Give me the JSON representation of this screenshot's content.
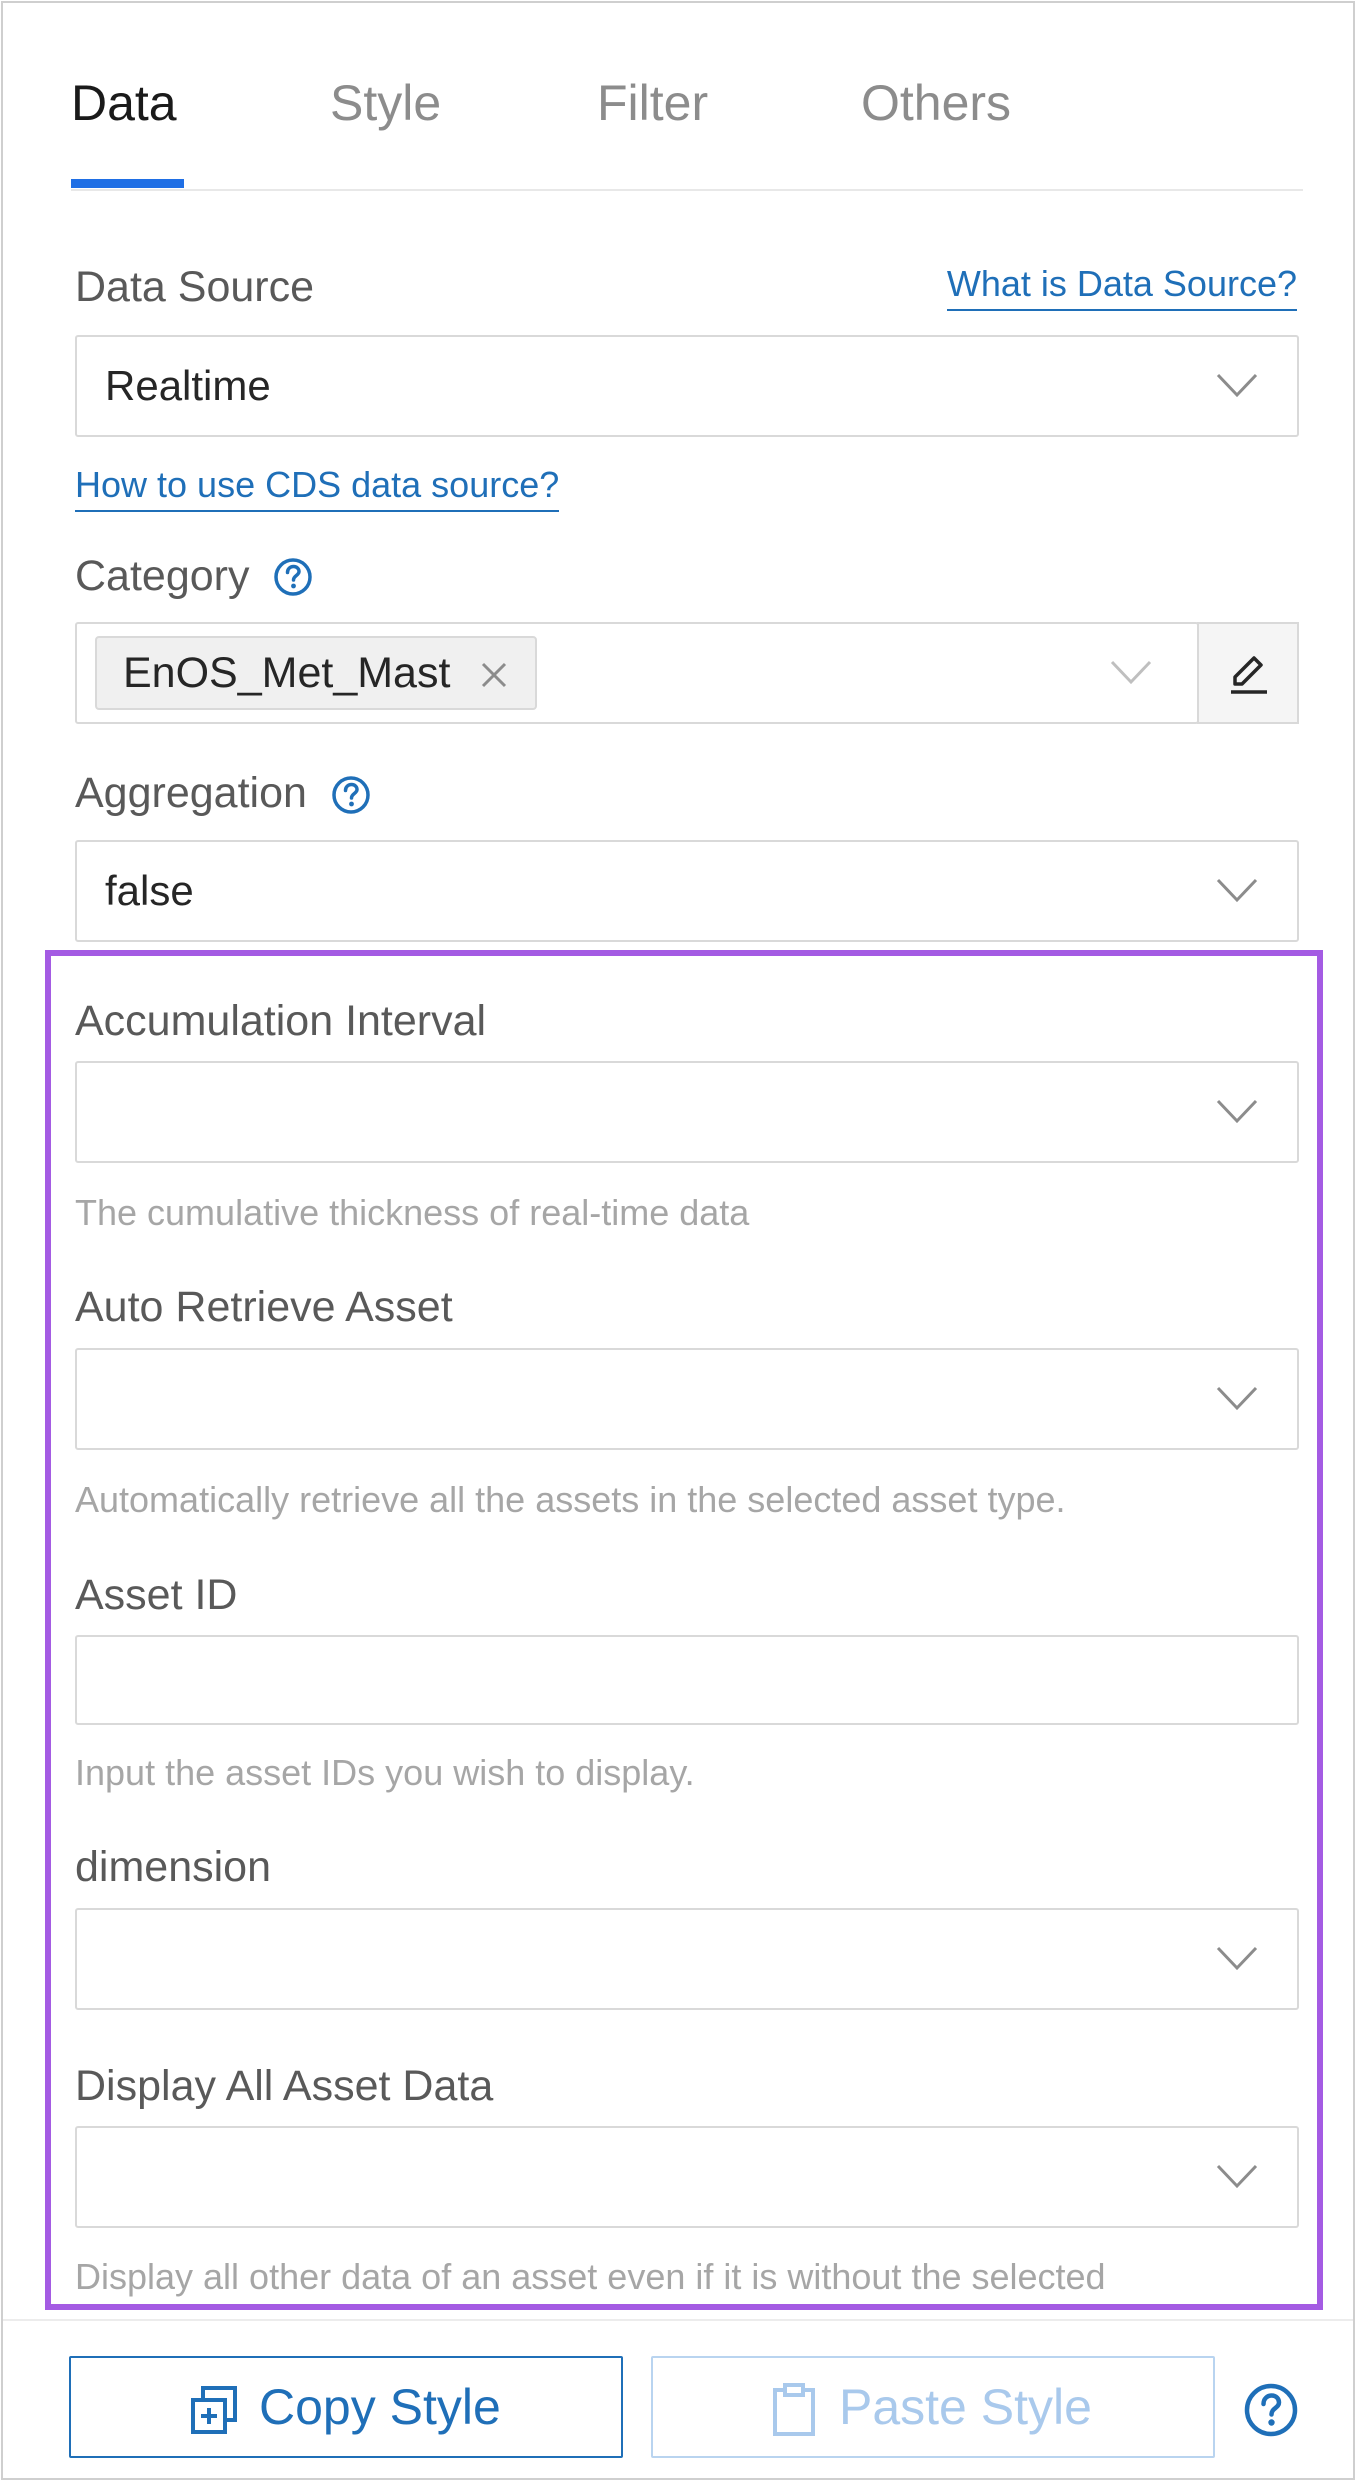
{
  "tabs": [
    {
      "label": "Data",
      "active": true
    },
    {
      "label": "Style",
      "active": false
    },
    {
      "label": "Filter",
      "active": false
    },
    {
      "label": "Others",
      "active": false
    }
  ],
  "data_source": {
    "label": "Data Source",
    "help_link": "What is Data Source?",
    "value": "Realtime",
    "cds_link": "How to use CDS data source?"
  },
  "category": {
    "label": "Category",
    "tag": "EnOS_Met_Mast"
  },
  "aggregation": {
    "label": "Aggregation",
    "value": "false"
  },
  "accumulation_interval": {
    "label": "Accumulation Interval",
    "value": "",
    "hint": "The cumulative thickness of real-time data"
  },
  "auto_retrieve_asset": {
    "label": "Auto Retrieve Asset",
    "value": "",
    "hint": "Automatically retrieve all the assets in the selected asset type."
  },
  "asset_id": {
    "label": "Asset ID",
    "value": "",
    "hint": "Input the asset IDs you wish to display."
  },
  "dimension": {
    "label": "dimension",
    "value": ""
  },
  "display_all_asset_data": {
    "label": "Display All Asset Data",
    "value": "",
    "hint": "Display all other data of an asset even if it is without the selected"
  },
  "footer": {
    "copy_style": "Copy Style",
    "paste_style": "Paste Style"
  },
  "colors": {
    "accent": "#1f6fe5",
    "link": "#1f6fb8",
    "highlight": "#a45be3"
  }
}
